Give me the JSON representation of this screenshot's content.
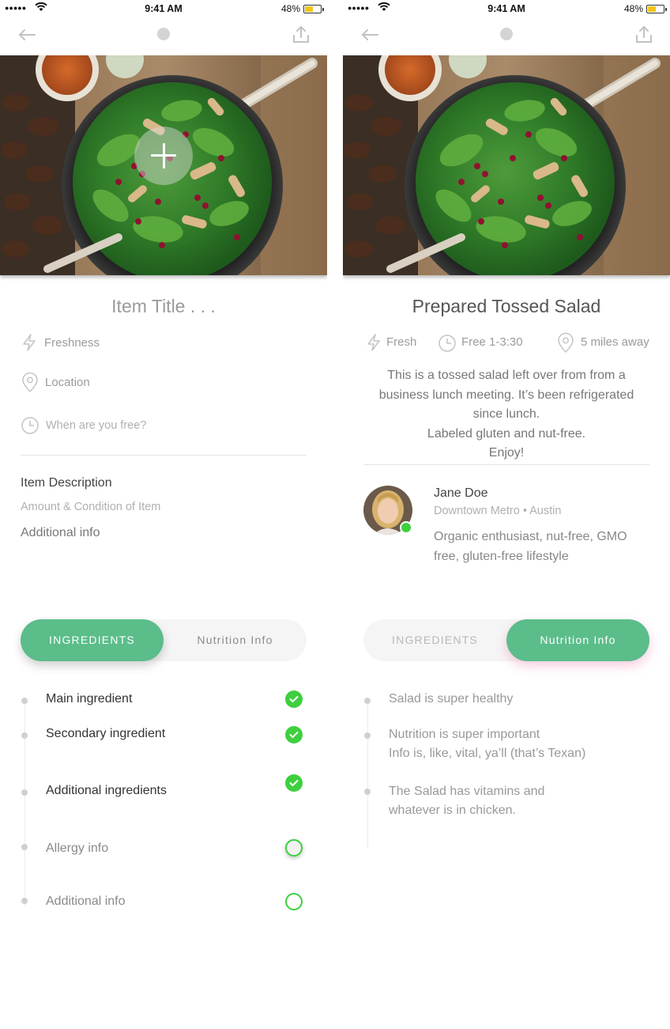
{
  "status_bar": {
    "signal": "●●●●●",
    "time": "9:41 AM",
    "battery_pct": "48%",
    "battery_level": 0.48
  },
  "left_screen": {
    "item_title_placeholder": "Item Title . . .",
    "fields": {
      "freshness": "Freshness",
      "location": "Location",
      "when_free": "When are you free?"
    },
    "description": {
      "title": "Item Description",
      "placeholder": "Amount & Condition of Item",
      "additional": "Additional info"
    },
    "tabs": {
      "ingredients": "INGREDIENTS",
      "nutrition": "Nutrition Info",
      "active": "ingredients"
    },
    "ingredients": [
      {
        "label": "Main ingredient",
        "checked": true
      },
      {
        "label": "Secondary ingredient",
        "checked": true
      },
      {
        "label": "Additional ingredients",
        "checked": true
      },
      {
        "label": "Allergy info",
        "checked": false
      },
      {
        "label": "Additional info",
        "checked": false
      }
    ]
  },
  "right_screen": {
    "title": "Prepared Tossed Salad",
    "meta": {
      "freshness": "Fresh",
      "time": "Free 1-3:30",
      "distance": "5 miles away"
    },
    "description_lines": [
      "This is a tossed salad left over from from a business lunch meeting. It’s been refrigerated since lunch.",
      "Labeled gluten and nut-free.",
      "Enjoy!"
    ],
    "profile": {
      "name": "Jane Doe",
      "location": "Downtown Metro • Austin",
      "bio": "Organic enthusiast, nut-free, GMO free, gluten-free lifestyle",
      "online": true
    },
    "tabs": {
      "ingredients": "INGREDIENTS",
      "nutrition": "Nutrition Info",
      "active": "nutrition"
    },
    "nutrition": [
      {
        "line1": "Salad is super healthy",
        "line2": ""
      },
      {
        "line1": "Nutrition is super important",
        "line2": "Info is, like, vital, ya’ll (that’s Texan)"
      },
      {
        "line1": "The Salad has vitamins and",
        "line2": "whatever is in chicken."
      }
    ]
  },
  "colors": {
    "accent_green": "#5bbd8a",
    "check_green": "#3ecf3e",
    "battery_yellow": "#f5c518"
  }
}
